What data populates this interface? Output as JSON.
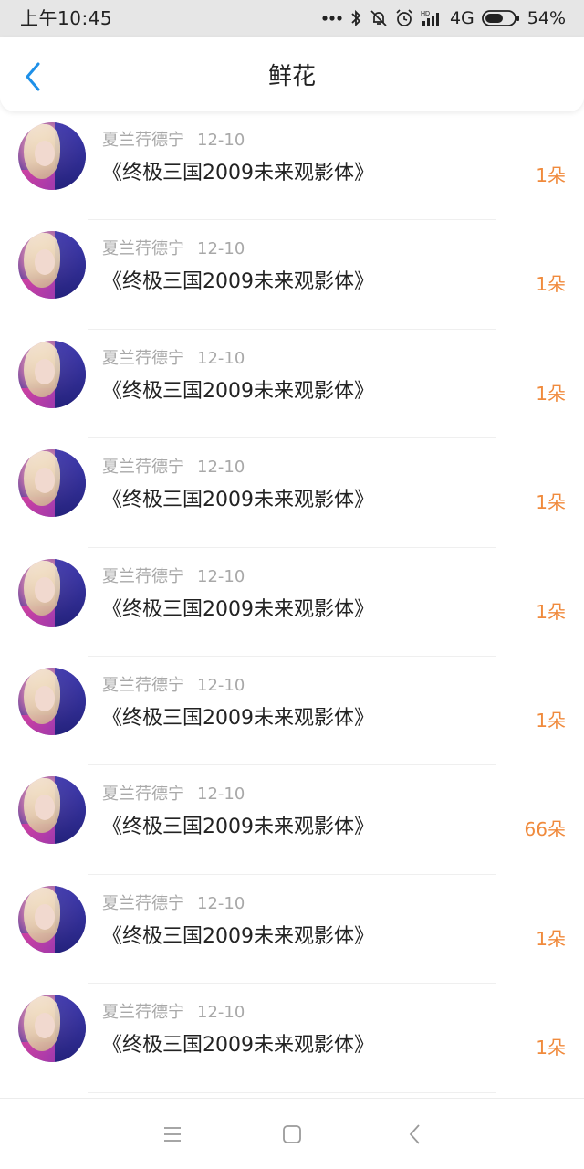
{
  "status_bar": {
    "time": "上午10:45",
    "network": "4G",
    "battery": "54%"
  },
  "header": {
    "title": "鲜花"
  },
  "colors": {
    "accent_back": "#1e90e8",
    "count_orange": "#f08a3c",
    "meta_gray": "#a8a8a8"
  },
  "icons": {
    "back": "chevron-left-icon",
    "menu": "menu-icon",
    "home": "square-icon",
    "nav_back": "chevron-left-icon"
  },
  "items": [
    {
      "user": "夏兰荇德宁",
      "date": "12-10",
      "title": "《终极三国2009未来观影体》",
      "count": "1朵"
    },
    {
      "user": "夏兰荇德宁",
      "date": "12-10",
      "title": "《终极三国2009未来观影体》",
      "count": "1朵"
    },
    {
      "user": "夏兰荇德宁",
      "date": "12-10",
      "title": "《终极三国2009未来观影体》",
      "count": "1朵"
    },
    {
      "user": "夏兰荇德宁",
      "date": "12-10",
      "title": "《终极三国2009未来观影体》",
      "count": "1朵"
    },
    {
      "user": "夏兰荇德宁",
      "date": "12-10",
      "title": "《终极三国2009未来观影体》",
      "count": "1朵"
    },
    {
      "user": "夏兰荇德宁",
      "date": "12-10",
      "title": "《终极三国2009未来观影体》",
      "count": "1朵"
    },
    {
      "user": "夏兰荇德宁",
      "date": "12-10",
      "title": "《终极三国2009未来观影体》",
      "count": "66朵"
    },
    {
      "user": "夏兰荇德宁",
      "date": "12-10",
      "title": "《终极三国2009未来观影体》",
      "count": "1朵"
    },
    {
      "user": "夏兰荇德宁",
      "date": "12-10",
      "title": "《终极三国2009未来观影体》",
      "count": "1朵"
    }
  ]
}
